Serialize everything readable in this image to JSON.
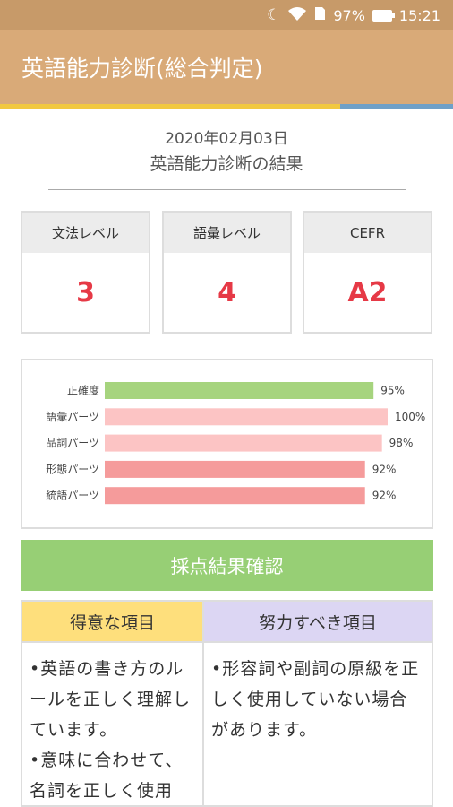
{
  "status": {
    "battery": "97%",
    "time": "15:21"
  },
  "appbar": {
    "title": "英語能力診断(総合判定)"
  },
  "header": {
    "date": "2020年02月03日",
    "title": "英語能力診断の結果"
  },
  "cards": [
    {
      "label": "文法レベル",
      "value": "3"
    },
    {
      "label": "語彙レベル",
      "value": "4"
    },
    {
      "label": "CEFR",
      "value": "A2"
    }
  ],
  "chart_data": {
    "type": "bar",
    "orientation": "horizontal",
    "categories": [
      "正確度",
      "語彙パーツ",
      "品詞パーツ",
      "形態パーツ",
      "統語パーツ"
    ],
    "values": [
      95,
      100,
      98,
      92,
      92
    ],
    "data_labels": [
      "95%",
      "100%",
      "98%",
      "92%",
      "92%"
    ],
    "colors": [
      "#a6d47e",
      "#fcc4c4",
      "#fcc4c4",
      "#f59b9b",
      "#f59b9b"
    ],
    "xlim": [
      0,
      100
    ],
    "grid": false
  },
  "confirm_button": {
    "label": "採点結果確認"
  },
  "strengths": {
    "title": "得意な項目",
    "items": [
      "•英語の書き方のルールを正しく理解しています。",
      "•意味に合わせて、名詞を正しく使用"
    ]
  },
  "weaknesses": {
    "title": "努力すべき項目",
    "items": [
      "•形容詞や副詞の原級を正しく使用していない場合があります。"
    ]
  }
}
